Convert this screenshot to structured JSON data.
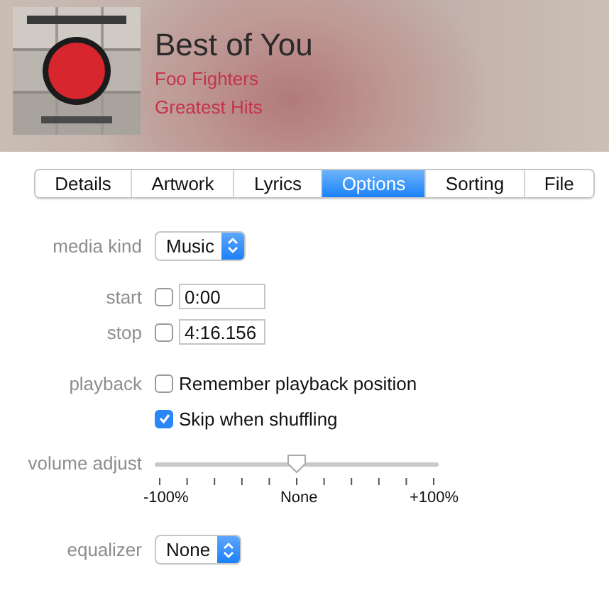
{
  "header": {
    "title": "Best of You",
    "artist": "Foo Fighters",
    "album": "Greatest Hits"
  },
  "tabs": [
    {
      "label": "Details",
      "selected": false
    },
    {
      "label": "Artwork",
      "selected": false
    },
    {
      "label": "Lyrics",
      "selected": false
    },
    {
      "label": "Options",
      "selected": true
    },
    {
      "label": "Sorting",
      "selected": false
    },
    {
      "label": "File",
      "selected": false
    }
  ],
  "media_kind": {
    "label": "media kind",
    "value": "Music"
  },
  "times": [
    {
      "label": "start",
      "checked": false,
      "value": "0:00"
    },
    {
      "label": "stop",
      "checked": false,
      "value": "4:16.156"
    }
  ],
  "playback": {
    "label": "playback",
    "options": [
      {
        "label": "Remember playback position",
        "checked": false
      },
      {
        "label": "Skip when shuffling",
        "checked": true
      }
    ]
  },
  "volume_adjust": {
    "label": "volume adjust",
    "level": 0.5,
    "scale": [
      "-100%",
      "None",
      "+100%"
    ]
  },
  "equalizer": {
    "label": "equalizer",
    "value": "None"
  }
}
